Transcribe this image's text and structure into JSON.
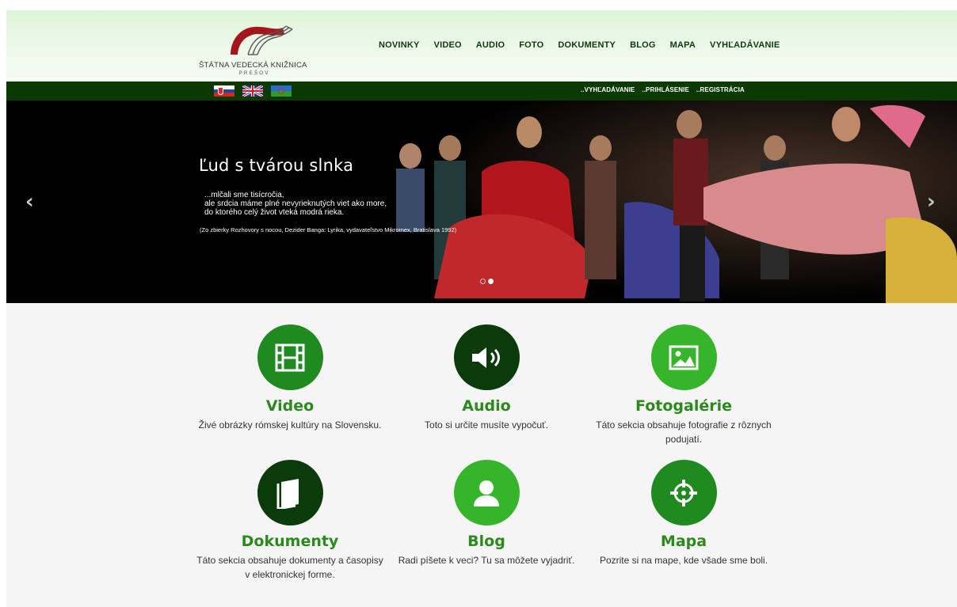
{
  "brand": {
    "name": "ŠTÁTNA VEDECKÁ KNIŽNICA",
    "subtitle": "PREŠOV",
    "colors": {
      "red": "#a3161b",
      "dark_green": "#0a3a02"
    }
  },
  "main_nav": [
    "NOVINKY",
    "VIDEO",
    "AUDIO",
    "FOTO",
    "DOKUMENTY",
    "BLOG",
    "MAPA",
    "VYHĽADÁVANIE"
  ],
  "languages": [
    {
      "icon": "slovak-flag-icon"
    },
    {
      "icon": "uk-flag-icon"
    },
    {
      "icon": "romani-flag-icon"
    }
  ],
  "utility_nav": [
    "..VYHĽADÁVANIE",
    "..PRIHLÁSENIE",
    "..REGISTRÁCIA"
  ],
  "hero": {
    "title": "Ľud s tvárou slnka",
    "poem": "...mlčali sme tisícročia,\nale srdcia máme plné nevyrieknutých viet ako more,\ndo ktorého celý život vteká modrá rieka.",
    "citation": "(Zo zbierky Rozhovory s nocou, Dezider Banga: Lyrika, vydavateľstvo Mikromex, Bratislava 1992)",
    "prev_icon": "chevron-left-icon",
    "next_icon": "chevron-right-icon",
    "slides": 2,
    "active_slide": 2
  },
  "cards": [
    {
      "title": "Video",
      "description": "Živé obrázky rómskej kultúry na Slovensku.",
      "icon": "film-icon",
      "color": "#1f8a1f",
      "title_color": "#2c8a1c"
    },
    {
      "title": "Audio",
      "description": "Toto si určite musíte vypočuť.",
      "icon": "volume-icon",
      "color": "#0b3a0b",
      "title_color": "#2c8a1c"
    },
    {
      "title": "Fotogalérie",
      "description": "Táto sekcia obsahuje fotografie z rôznych podujatí.",
      "icon": "picture-icon",
      "color": "#36b52b",
      "title_color": "#2c8a1c"
    },
    {
      "title": "Dokumenty",
      "description": "Táto sekcia obsahuje dokumenty a časopisy v elektronickej forme.",
      "icon": "book-icon",
      "color": "#0b3a0b",
      "title_color": "#2c8a1c"
    },
    {
      "title": "Blog",
      "description": "Radi píšete k veci? Tu sa môžete vyjadriť.",
      "icon": "user-icon",
      "color": "#36b52b",
      "title_color": "#2c8a1c"
    },
    {
      "title": "Mapa",
      "description": "Pozrite si na mape, kde všade sme boli.",
      "icon": "map-marker-icon",
      "color": "#1f8a1f",
      "title_color": "#2c8a1c"
    }
  ]
}
